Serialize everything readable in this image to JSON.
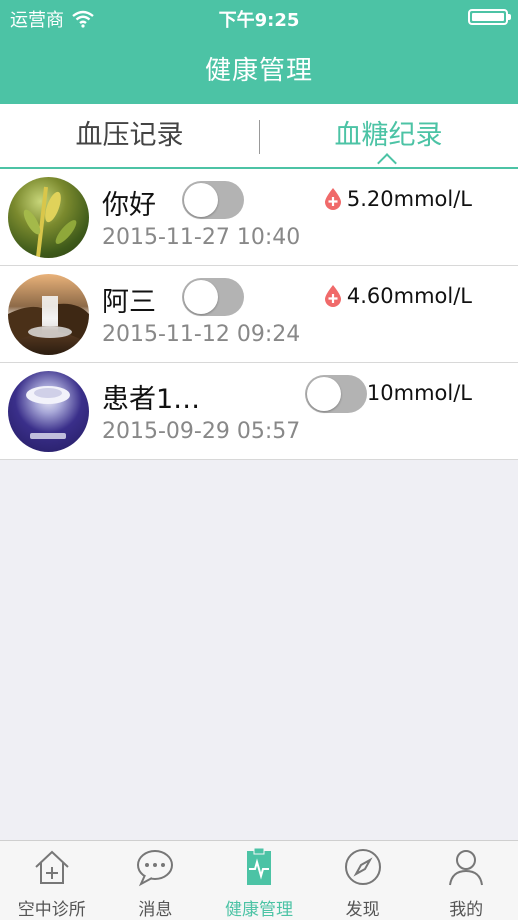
{
  "status_bar": {
    "carrier": "运营商",
    "time": "下午9:25"
  },
  "nav": {
    "title": "健康管理"
  },
  "tabs": [
    {
      "label": "血压记录",
      "selected": false
    },
    {
      "label": "血糖纪录",
      "selected": true
    }
  ],
  "records": [
    {
      "name": "你好",
      "date": "2015-11-27 10:40",
      "value": "5.20mmol/L",
      "toggle_on": false
    },
    {
      "name": "阿三",
      "date": "2015-11-12 09:24",
      "value": "4.60mmol/L",
      "toggle_on": false
    },
    {
      "name": "患者1…",
      "date": "2015-09-29 05:57",
      "value": "10mmol/L",
      "toggle_on": false
    }
  ],
  "tabbar": [
    {
      "label": "空中诊所",
      "icon": "house-plus-icon"
    },
    {
      "label": "消息",
      "icon": "chat-bubble-icon"
    },
    {
      "label": "健康管理",
      "icon": "health-clipboard-icon",
      "active": true
    },
    {
      "label": "发现",
      "icon": "compass-icon"
    },
    {
      "label": "我的",
      "icon": "person-icon"
    }
  ],
  "colors": {
    "brand": "#4cc3a5",
    "drop": "#f06a6a",
    "toggle_off": "#b3b3b3"
  }
}
